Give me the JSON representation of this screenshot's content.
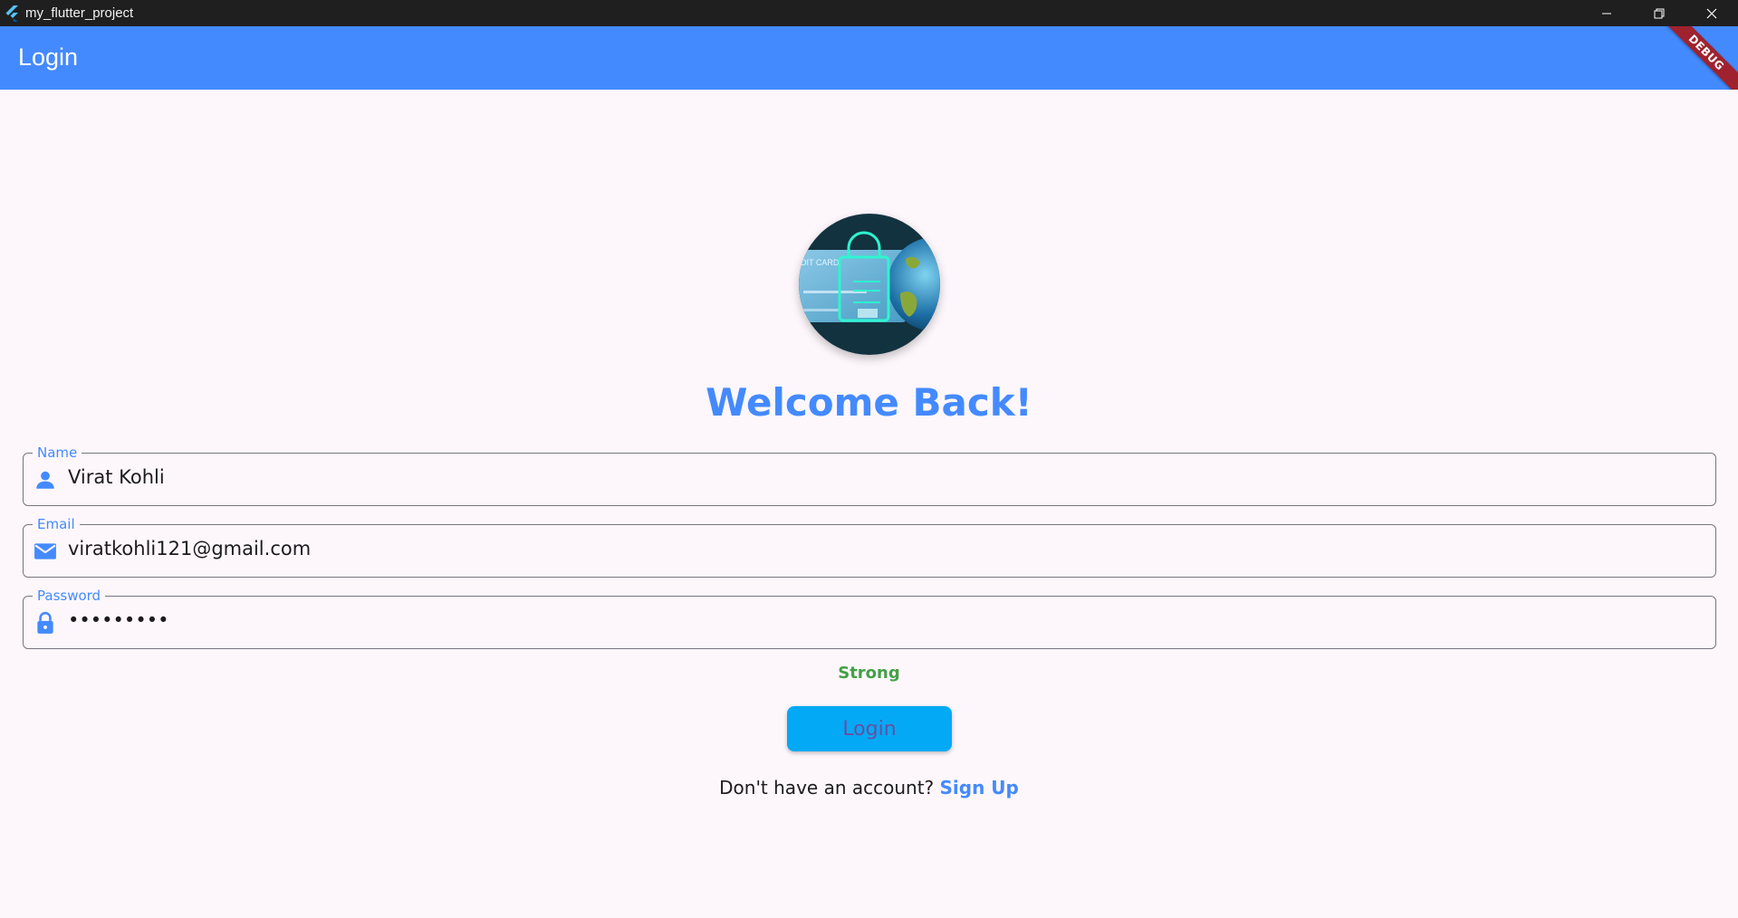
{
  "window": {
    "title": "my_flutter_project",
    "icons": [
      "flutter-logo-icon",
      "minimize-icon",
      "restore-icon",
      "close-icon"
    ]
  },
  "appbar": {
    "title": "Login",
    "debug_banner": "DEBUG",
    "color": "#448aff"
  },
  "main": {
    "welcome": "Welcome Back!",
    "fields": {
      "name": {
        "label": "Name",
        "value": "Virat Kohli",
        "icon": "person-icon"
      },
      "email": {
        "label": "Email",
        "value": "viratkohli121@gmail.com",
        "icon": "mail-icon"
      },
      "password": {
        "label": "Password",
        "value": "•••••••••",
        "icon": "lock-icon"
      }
    },
    "password_strength": "Strong",
    "login_button": "Login",
    "signup_prompt": "Don't have an account?",
    "signup_link": "Sign Up"
  },
  "colors": {
    "primary": "#448aff",
    "strength_strong": "#43a047",
    "button_bg": "#03a9f4",
    "button_text": "#6750a4",
    "background": "#fdf7fc"
  }
}
